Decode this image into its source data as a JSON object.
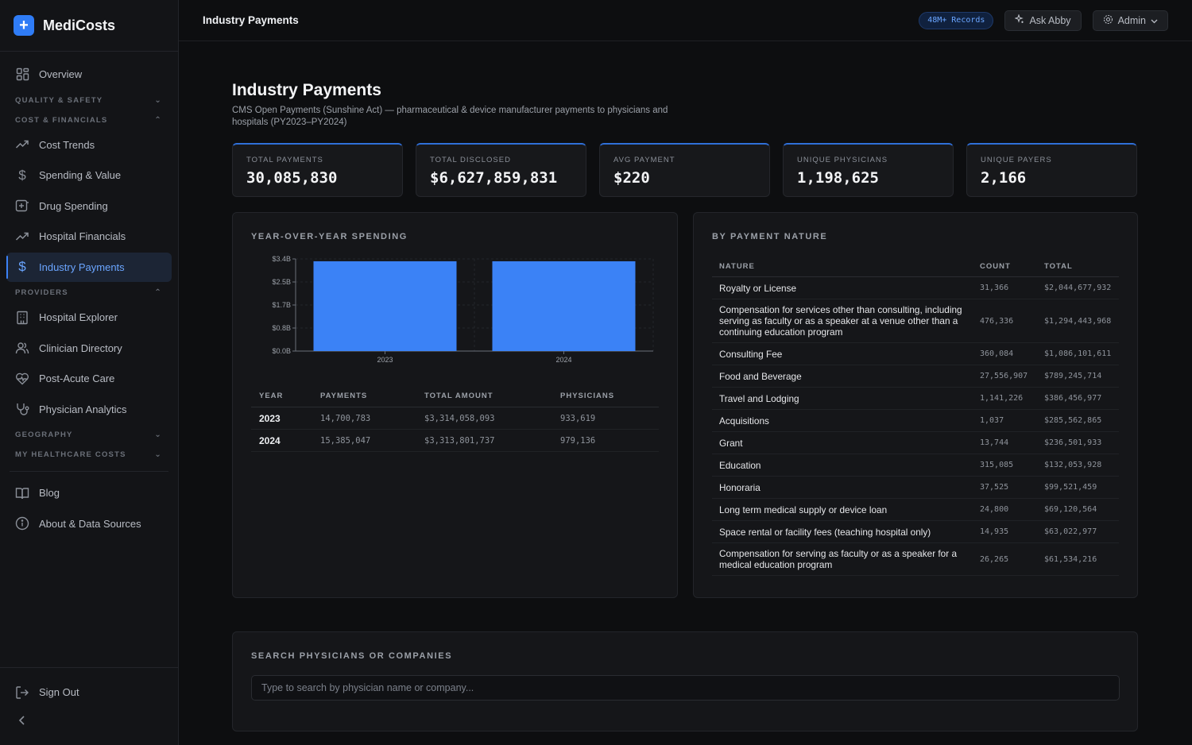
{
  "brand": {
    "name": "MediCosts",
    "logo_glyph": "+"
  },
  "sidebar": {
    "overview": "Overview",
    "sections": {
      "quality": "QUALITY & SAFETY",
      "cost": "COST & FINANCIALS",
      "providers": "PROVIDERS",
      "geography": "GEOGRAPHY",
      "my_costs": "MY HEALTHCARE COSTS"
    },
    "cost_items": [
      "Cost Trends",
      "Spending & Value",
      "Drug Spending",
      "Hospital Financials",
      "Industry Payments"
    ],
    "provider_items": [
      "Hospital Explorer",
      "Clinician Directory",
      "Post-Acute Care",
      "Physician Analytics"
    ],
    "misc_items": [
      "Blog",
      "About & Data Sources"
    ],
    "sign_out": "Sign Out"
  },
  "topbar": {
    "title": "Industry Payments",
    "records_badge": "48M+ Records",
    "ask_label": "Ask Abby",
    "admin_label": "Admin"
  },
  "page": {
    "title": "Industry Payments",
    "subtitle": "CMS Open Payments (Sunshine Act) — pharmaceutical & device manufacturer payments to physicians and hospitals (PY2023–PY2024)"
  },
  "kpis": [
    {
      "label": "TOTAL PAYMENTS",
      "value": "30,085,830"
    },
    {
      "label": "TOTAL DISCLOSED",
      "value": "$6,627,859,831"
    },
    {
      "label": "AVG PAYMENT",
      "value": "$220"
    },
    {
      "label": "UNIQUE PHYSICIANS",
      "value": "1,198,625"
    },
    {
      "label": "UNIQUE PAYERS",
      "value": "2,166"
    }
  ],
  "yoy": {
    "title": "YEAR-OVER-YEAR SPENDING",
    "headers": [
      "YEAR",
      "PAYMENTS",
      "TOTAL AMOUNT",
      "PHYSICIANS"
    ],
    "rows": [
      [
        "2023",
        "14,700,783",
        "$3,314,058,093",
        "933,619"
      ],
      [
        "2024",
        "15,385,047",
        "$3,313,801,737",
        "979,136"
      ]
    ]
  },
  "chart_data": {
    "type": "bar",
    "categories": [
      "2023",
      "2024"
    ],
    "values": [
      3314058093,
      3313801737
    ],
    "ylim": [
      0,
      3400000000
    ],
    "yticks": [
      "$0.0B",
      "$0.8B",
      "$1.7B",
      "$2.5B",
      "$3.4B"
    ],
    "ytick_values": [
      0,
      850000000,
      1700000000,
      2550000000,
      3400000000
    ],
    "title": "",
    "xlabel": "",
    "ylabel": "",
    "bar_color": "#3b82f6",
    "grid": true
  },
  "nature": {
    "title": "BY PAYMENT NATURE",
    "headers": [
      "NATURE",
      "COUNT",
      "TOTAL"
    ],
    "rows": [
      [
        "Royalty or License",
        "31,366",
        "$2,044,677,932"
      ],
      [
        "Compensation for services other than consulting, including serving as faculty or as a speaker at a venue other than a continuing education program",
        "476,336",
        "$1,294,443,968"
      ],
      [
        "Consulting Fee",
        "360,084",
        "$1,086,101,611"
      ],
      [
        "Food and Beverage",
        "27,556,907",
        "$789,245,714"
      ],
      [
        "Travel and Lodging",
        "1,141,226",
        "$386,456,977"
      ],
      [
        "Acquisitions",
        "1,037",
        "$285,562,865"
      ],
      [
        "Grant",
        "13,744",
        "$236,501,933"
      ],
      [
        "Education",
        "315,085",
        "$132,053,928"
      ],
      [
        "Honoraria",
        "37,525",
        "$99,521,459"
      ],
      [
        "Long term medical supply or device loan",
        "24,800",
        "$69,120,564"
      ],
      [
        "Space rental or facility fees (teaching hospital only)",
        "14,935",
        "$63,022,977"
      ],
      [
        "Compensation for serving as faculty or as a speaker for a medical education program",
        "26,265",
        "$61,534,216"
      ]
    ]
  },
  "search": {
    "title": "SEARCH PHYSICIANS OR COMPANIES",
    "placeholder": "Type to search by physician name or company..."
  }
}
